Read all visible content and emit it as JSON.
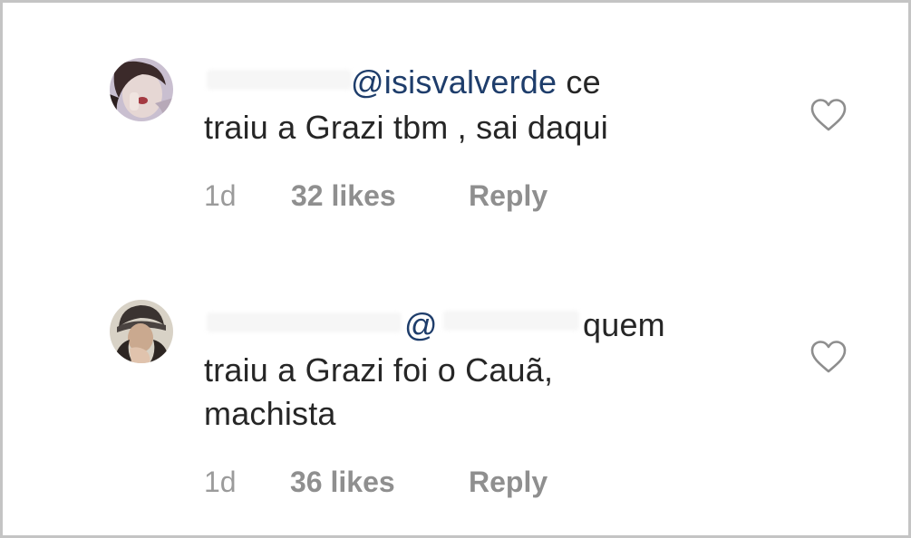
{
  "comments": [
    {
      "mention": "@isisvalverde",
      "line1_rest": " ce",
      "line2": "traiu a Grazi tbm , sai daqui",
      "time": "1d",
      "likes": "32 likes",
      "reply": "Reply"
    },
    {
      "mention": "@",
      "line1_rest": "quem",
      "line2": "traiu a Grazi foi o Cauã,",
      "line3": "machista",
      "time": "1d",
      "likes": "36 likes",
      "reply": "Reply"
    }
  ],
  "colors": {
    "text": "#262626",
    "mention": "#1e3d6b",
    "meta": "#9b9b9b",
    "border": "#c4c4c4"
  },
  "icons": {
    "like": "heart-outline-icon"
  }
}
